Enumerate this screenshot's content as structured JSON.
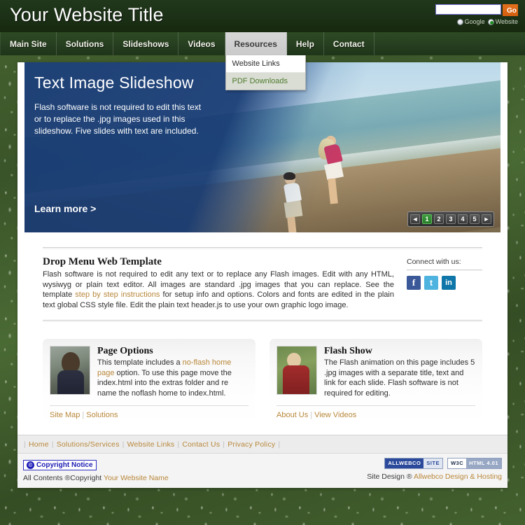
{
  "header": {
    "site_title": "Your Website Title",
    "search": {
      "value": "",
      "placeholder": "",
      "go_label": "Go"
    },
    "radios": [
      {
        "label": "Google",
        "selected": false
      },
      {
        "label": "Website",
        "selected": true
      }
    ]
  },
  "nav": {
    "items": [
      {
        "label": "Main Site",
        "active": false
      },
      {
        "label": "Solutions",
        "active": false
      },
      {
        "label": "Slideshows",
        "active": false
      },
      {
        "label": "Videos",
        "active": false
      },
      {
        "label": "Resources",
        "active": true
      },
      {
        "label": "Help",
        "active": false
      },
      {
        "label": "Contact",
        "active": false
      }
    ],
    "dropdown": {
      "parent": "Resources",
      "items": [
        {
          "label": "Website Links",
          "hover": false
        },
        {
          "label": "PDF Downloads",
          "hover": true
        }
      ]
    }
  },
  "slideshow": {
    "title": "Text Image Slideshow",
    "description": "Flash software is not required to edit this text or to replace the .jpg images used in this slideshow. Five slides with text are included.",
    "cta": "Learn more >",
    "nav": {
      "prev": "◄",
      "next": "►",
      "slides": [
        "1",
        "2",
        "3",
        "4",
        "5"
      ],
      "active": "1"
    }
  },
  "intro": {
    "heading": "Drop Menu Web Template",
    "body_1": "Flash software is not required to edit any text or to replace any Flash images. Edit with any HTML, wysiwyg or plain text editor. All images are standard .jpg images that you can replace. See the template ",
    "link": "step by step instructions",
    "body_2": " for setup info and options. Colors and fonts are edited in the plain text global CSS style file. Edit the plain text header.js to use your own graphic logo image.",
    "connect_heading": "Connect with us:",
    "social": [
      {
        "name": "facebook-icon",
        "glyph": "f"
      },
      {
        "name": "twitter-icon",
        "glyph": "t"
      },
      {
        "name": "linkedin-icon",
        "glyph": "in"
      }
    ]
  },
  "boxes": [
    {
      "heading": "Page Options",
      "body_1": "This template includes a ",
      "link": "no-flash home page",
      "body_2": " option. To use this page move the index.html into the extras folder and re name the noflash home to index.html.",
      "links": [
        "Site Map",
        "Solutions"
      ],
      "image": "woman-portrait-thumbnail"
    },
    {
      "heading": "Flash Show",
      "body_1": "The Flash animation on this page includes 5 .jpg images with a separate title, text and link for each slide. Flash software is not required for editing.",
      "link": "",
      "body_2": "",
      "links": [
        "About Us",
        "View Videos"
      ],
      "image": "hiker-thumbnail"
    }
  ],
  "footer": {
    "links": [
      "Home",
      "Solutions/Services",
      "Website Links",
      "Contact Us",
      "Privacy Policy"
    ],
    "copyright_badge": "Copyright Notice",
    "copyright_symbol": "©",
    "copyright_text": "All Contents ®Copyright ",
    "copyright_name": "Your Website Name",
    "badges": [
      {
        "left": "ALLWEBCO",
        "right": "SITE"
      },
      {
        "left": "W3C",
        "right": "HTML 4.01"
      }
    ],
    "site_design_text": "Site Design ® ",
    "site_design_name": "Allwebco Design & Hosting"
  },
  "colors": {
    "header_green": "#1d3318",
    "nav_green": "#2d4a24",
    "accent_orange": "#b8873a",
    "go_orange": "#d4600f",
    "active_slide_green": "#2f8f2f",
    "link_blue": "#1b1bb5"
  }
}
